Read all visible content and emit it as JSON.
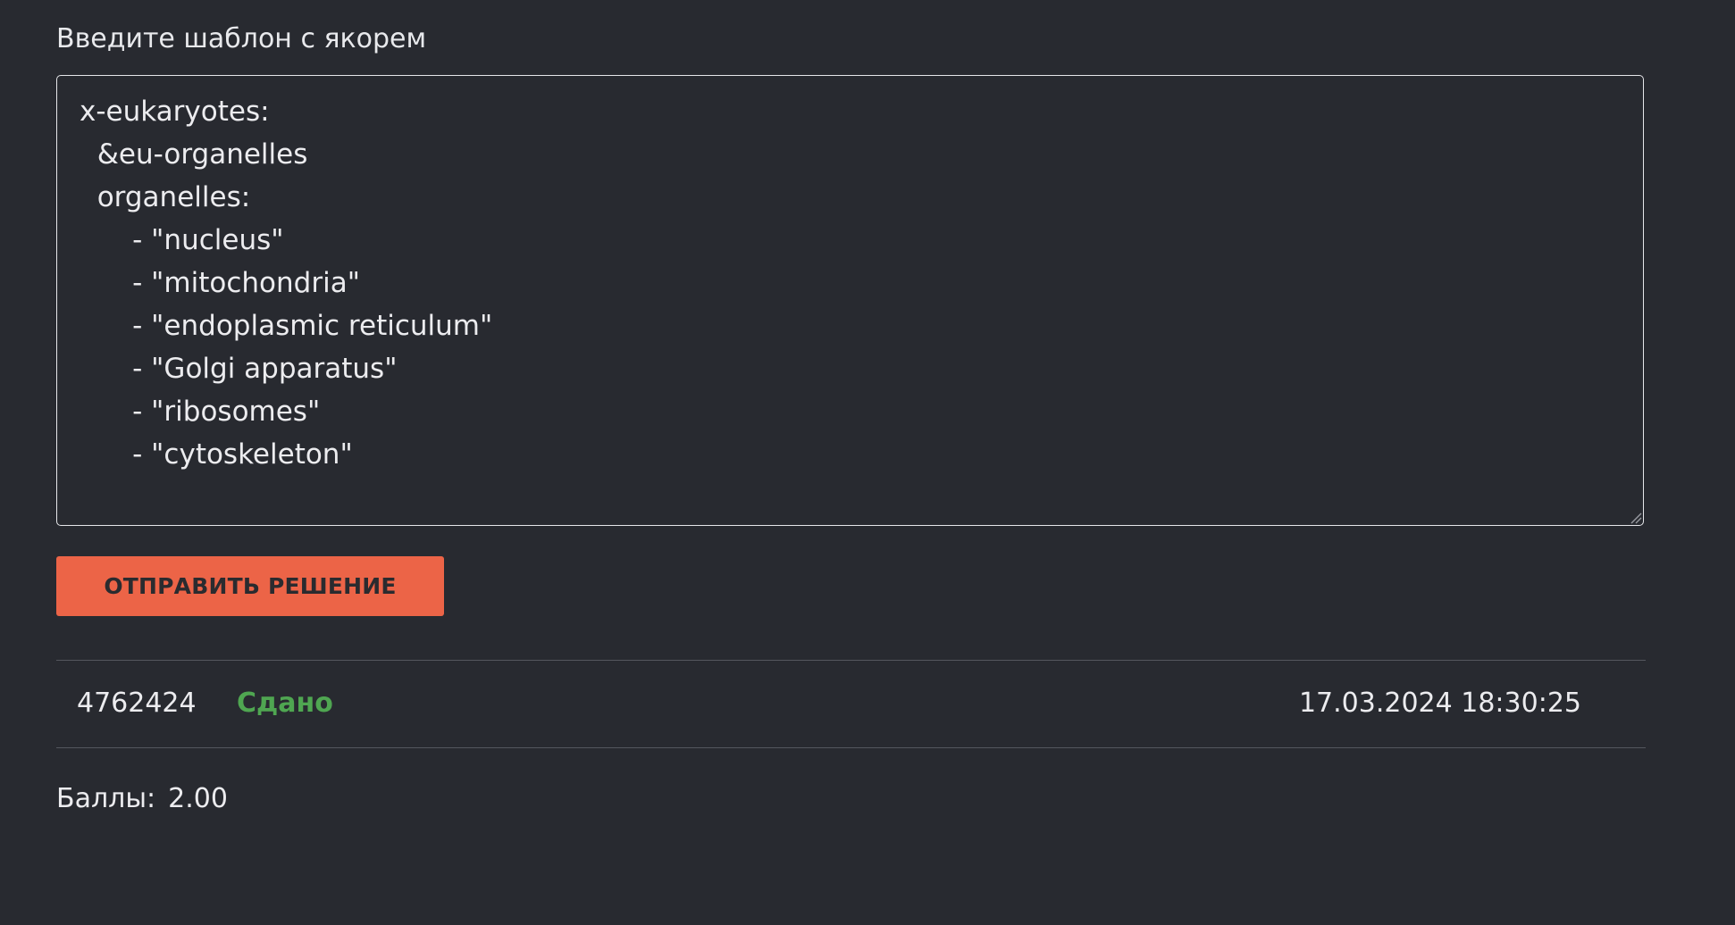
{
  "form": {
    "label": "Введите шаблон с якорем",
    "code_lines": [
      "x-eukaryotes:",
      "  &eu-organelles",
      "  organelles:",
      "      - \"nucleus\"",
      "      - \"mitochondria\"",
      "      - \"endoplasmic reticulum\"",
      "      - \"Golgi apparatus\"",
      "      - \"ribosomes\"",
      "      - \"cytoskeleton\""
    ],
    "submit_label": "ОТПРАВИТЬ РЕШЕНИЕ"
  },
  "submission": {
    "id": "4762424",
    "status": "Сдано",
    "timestamp": "17.03.2024 18:30:25"
  },
  "score": {
    "label": "Баллы:",
    "value": "2.00"
  },
  "colors": {
    "background": "#282a30",
    "accent": "#ec6447",
    "status_success": "#4fa651"
  }
}
